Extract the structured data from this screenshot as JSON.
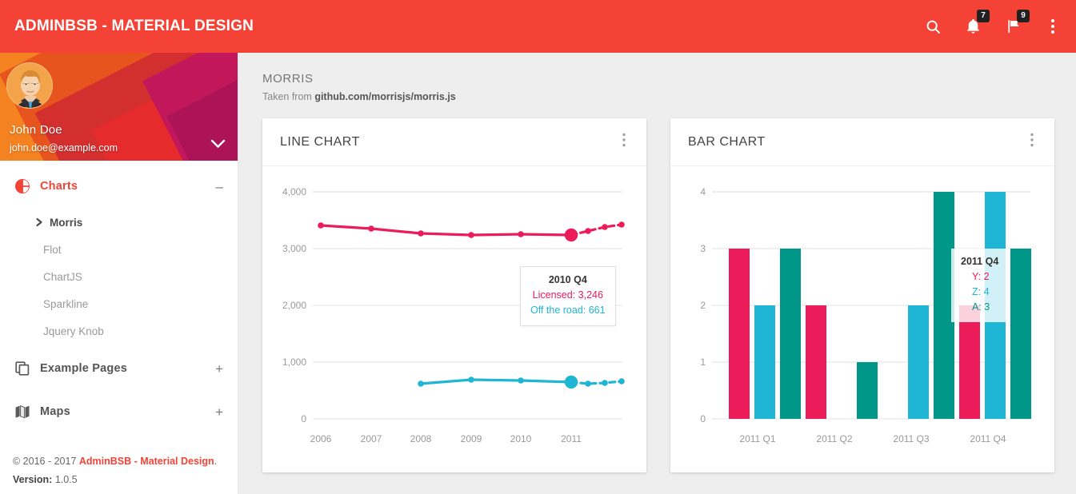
{
  "topbar": {
    "brand": "AdminBSB - Material Design",
    "icons": [
      {
        "name": "search-icon",
        "label": "Search"
      },
      {
        "name": "bell-icon",
        "label": "Notifications",
        "badge": "7"
      },
      {
        "name": "flag-icon",
        "label": "Tasks",
        "badge": "9"
      },
      {
        "name": "more-vert-icon",
        "label": "More"
      }
    ]
  },
  "sidebar": {
    "user": {
      "name": "John Doe",
      "email": "john.doe@example.com",
      "caret": "chevron-down-icon"
    },
    "menu": [
      {
        "label": "Charts",
        "icon": "pie-chart-icon",
        "toggle": "–",
        "active": true
      },
      {
        "label": "Example Pages",
        "icon": "copy-icon",
        "toggle": "+",
        "active": false
      },
      {
        "label": "Maps",
        "icon": "map-icon",
        "toggle": "+",
        "active": false
      }
    ],
    "submenu": [
      {
        "label": "Morris",
        "active": true
      },
      {
        "label": "Flot",
        "active": false
      },
      {
        "label": "ChartJS",
        "active": false
      },
      {
        "label": "Sparkline",
        "active": false
      },
      {
        "label": "Jquery Knob",
        "active": false
      }
    ],
    "footer": {
      "copyright_prefix": "© 2016 - 2017 ",
      "copyright_link": "AdminBSB - Material Design",
      "copyright_suffix": ".",
      "version_label": "Version:",
      "version_value": "1.0.5"
    }
  },
  "page": {
    "title": "MORRIS",
    "subtitle_prefix": "Taken from ",
    "subtitle_link": "github.com/morrisjs/morris.js"
  },
  "colors": {
    "brand_red": "#f44336",
    "pink": "#ec1b5a",
    "cyan": "#00bcd4",
    "teal": "#009688",
    "grid": "#e0e0e0",
    "tick": "#999999"
  },
  "cards": [
    {
      "title": "Line Chart",
      "menu": "more-vert-icon"
    },
    {
      "title": "Bar Chart",
      "menu": "more-vert-icon"
    }
  ],
  "chart_data": [
    {
      "type": "line",
      "title": "Line Chart",
      "xlabel": "",
      "ylabel": "",
      "ylim": [
        0,
        4000
      ],
      "yticks": [
        "0",
        "1,000",
        "2,000",
        "3,000",
        "4,000"
      ],
      "ytick_values": [
        0,
        1000,
        2000,
        3000,
        4000
      ],
      "xticks": [
        "2006",
        "2007",
        "2008",
        "2009",
        "2010",
        "2011"
      ],
      "grid": true,
      "legend": "none",
      "x": [
        "2006 Q1",
        "2007 Q1",
        "2008 Q1",
        "2009 Q1",
        "2010 Q1",
        "2010 Q4",
        "2011 Q1",
        "2011 Q2",
        "2011 Q3"
      ],
      "series": [
        {
          "name": "Licensed",
          "color": "#ec1b5a",
          "values": [
            3407,
            3351,
            3269,
            3246,
            3257,
            3246,
            3321,
            3416,
            3477
          ]
        },
        {
          "name": "Off the road",
          "color": "#00bcd4",
          "values": [
            null,
            null,
            634,
            727,
            716,
            661,
            645,
            658,
            688
          ]
        }
      ],
      "tooltip": {
        "title": "2010 Q4",
        "rows": [
          {
            "label": "Licensed",
            "value": "3,246",
            "text": "Licensed: 3,246",
            "color": "#ec1b5a"
          },
          {
            "label": "Off the road",
            "value": "661",
            "text": "Off the road: 661",
            "color": "#00bcd4"
          }
        ]
      }
    },
    {
      "type": "bar",
      "title": "Bar Chart",
      "xlabel": "",
      "ylabel": "",
      "ylim": [
        0,
        4
      ],
      "yticks": [
        "0",
        "1",
        "2",
        "3",
        "4"
      ],
      "ytick_values": [
        0,
        1,
        2,
        3,
        4
      ],
      "categories": [
        "2011 Q1",
        "2011 Q2",
        "2011 Q3",
        "2011 Q4"
      ],
      "grid": true,
      "legend": "none",
      "series": [
        {
          "name": "Y",
          "color": "#ec1b5a",
          "values": [
            3,
            2,
            0,
            2
          ]
        },
        {
          "name": "Z",
          "color": "#00bcd4",
          "values": [
            2,
            0,
            2,
            4
          ]
        },
        {
          "name": "A",
          "color": "#009688",
          "values": [
            3,
            1,
            4,
            3
          ]
        }
      ],
      "tooltip": {
        "title": "2011 Q4",
        "rows": [
          {
            "label": "Y",
            "value": "2",
            "text": "Y: 2",
            "color": "#ec1b5a"
          },
          {
            "label": "Z",
            "value": "4",
            "text": "Z: 4",
            "color": "#00bcd4"
          },
          {
            "label": "A",
            "value": "3",
            "text": "A: 3",
            "color": "#009688"
          }
        ]
      }
    }
  ]
}
